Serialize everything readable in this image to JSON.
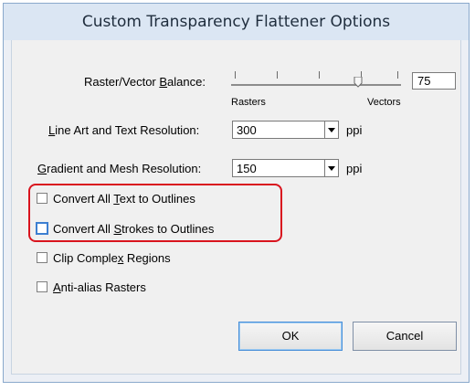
{
  "dialog": {
    "title": "Custom Transparency Flattener Options"
  },
  "raster_vector": {
    "label_pre": "Raster/Vector ",
    "label_ul": "B",
    "label_post": "alance:",
    "value": "75",
    "left_caption": "Rasters",
    "right_caption": "Vectors",
    "slider_fraction": 0.75
  },
  "line_art": {
    "label_ul": "L",
    "label_post": "ine Art and Text Resolution:",
    "value": "300",
    "unit": "ppi"
  },
  "gradient": {
    "label_ul": "G",
    "label_post": "radient and Mesh Resolution:",
    "value": "150",
    "unit": "ppi"
  },
  "options": {
    "text_outlines": {
      "pre": "Convert All ",
      "ul": "T",
      "post": "ext to Outlines",
      "checked": false
    },
    "stroke_outlines": {
      "pre": "Convert All ",
      "ul": "S",
      "post": "trokes to Outlines",
      "checked": false
    },
    "clip_regions": {
      "pre": "Clip Comple",
      "ul": "x",
      "post": " Regions",
      "checked": false
    },
    "antialias": {
      "pre": "",
      "ul": "A",
      "post": "nti-alias Rasters",
      "checked": false
    }
  },
  "buttons": {
    "ok": "OK",
    "cancel": "Cancel"
  },
  "colors": {
    "highlight": "#d9141e",
    "focus": "#3d7fd1"
  }
}
